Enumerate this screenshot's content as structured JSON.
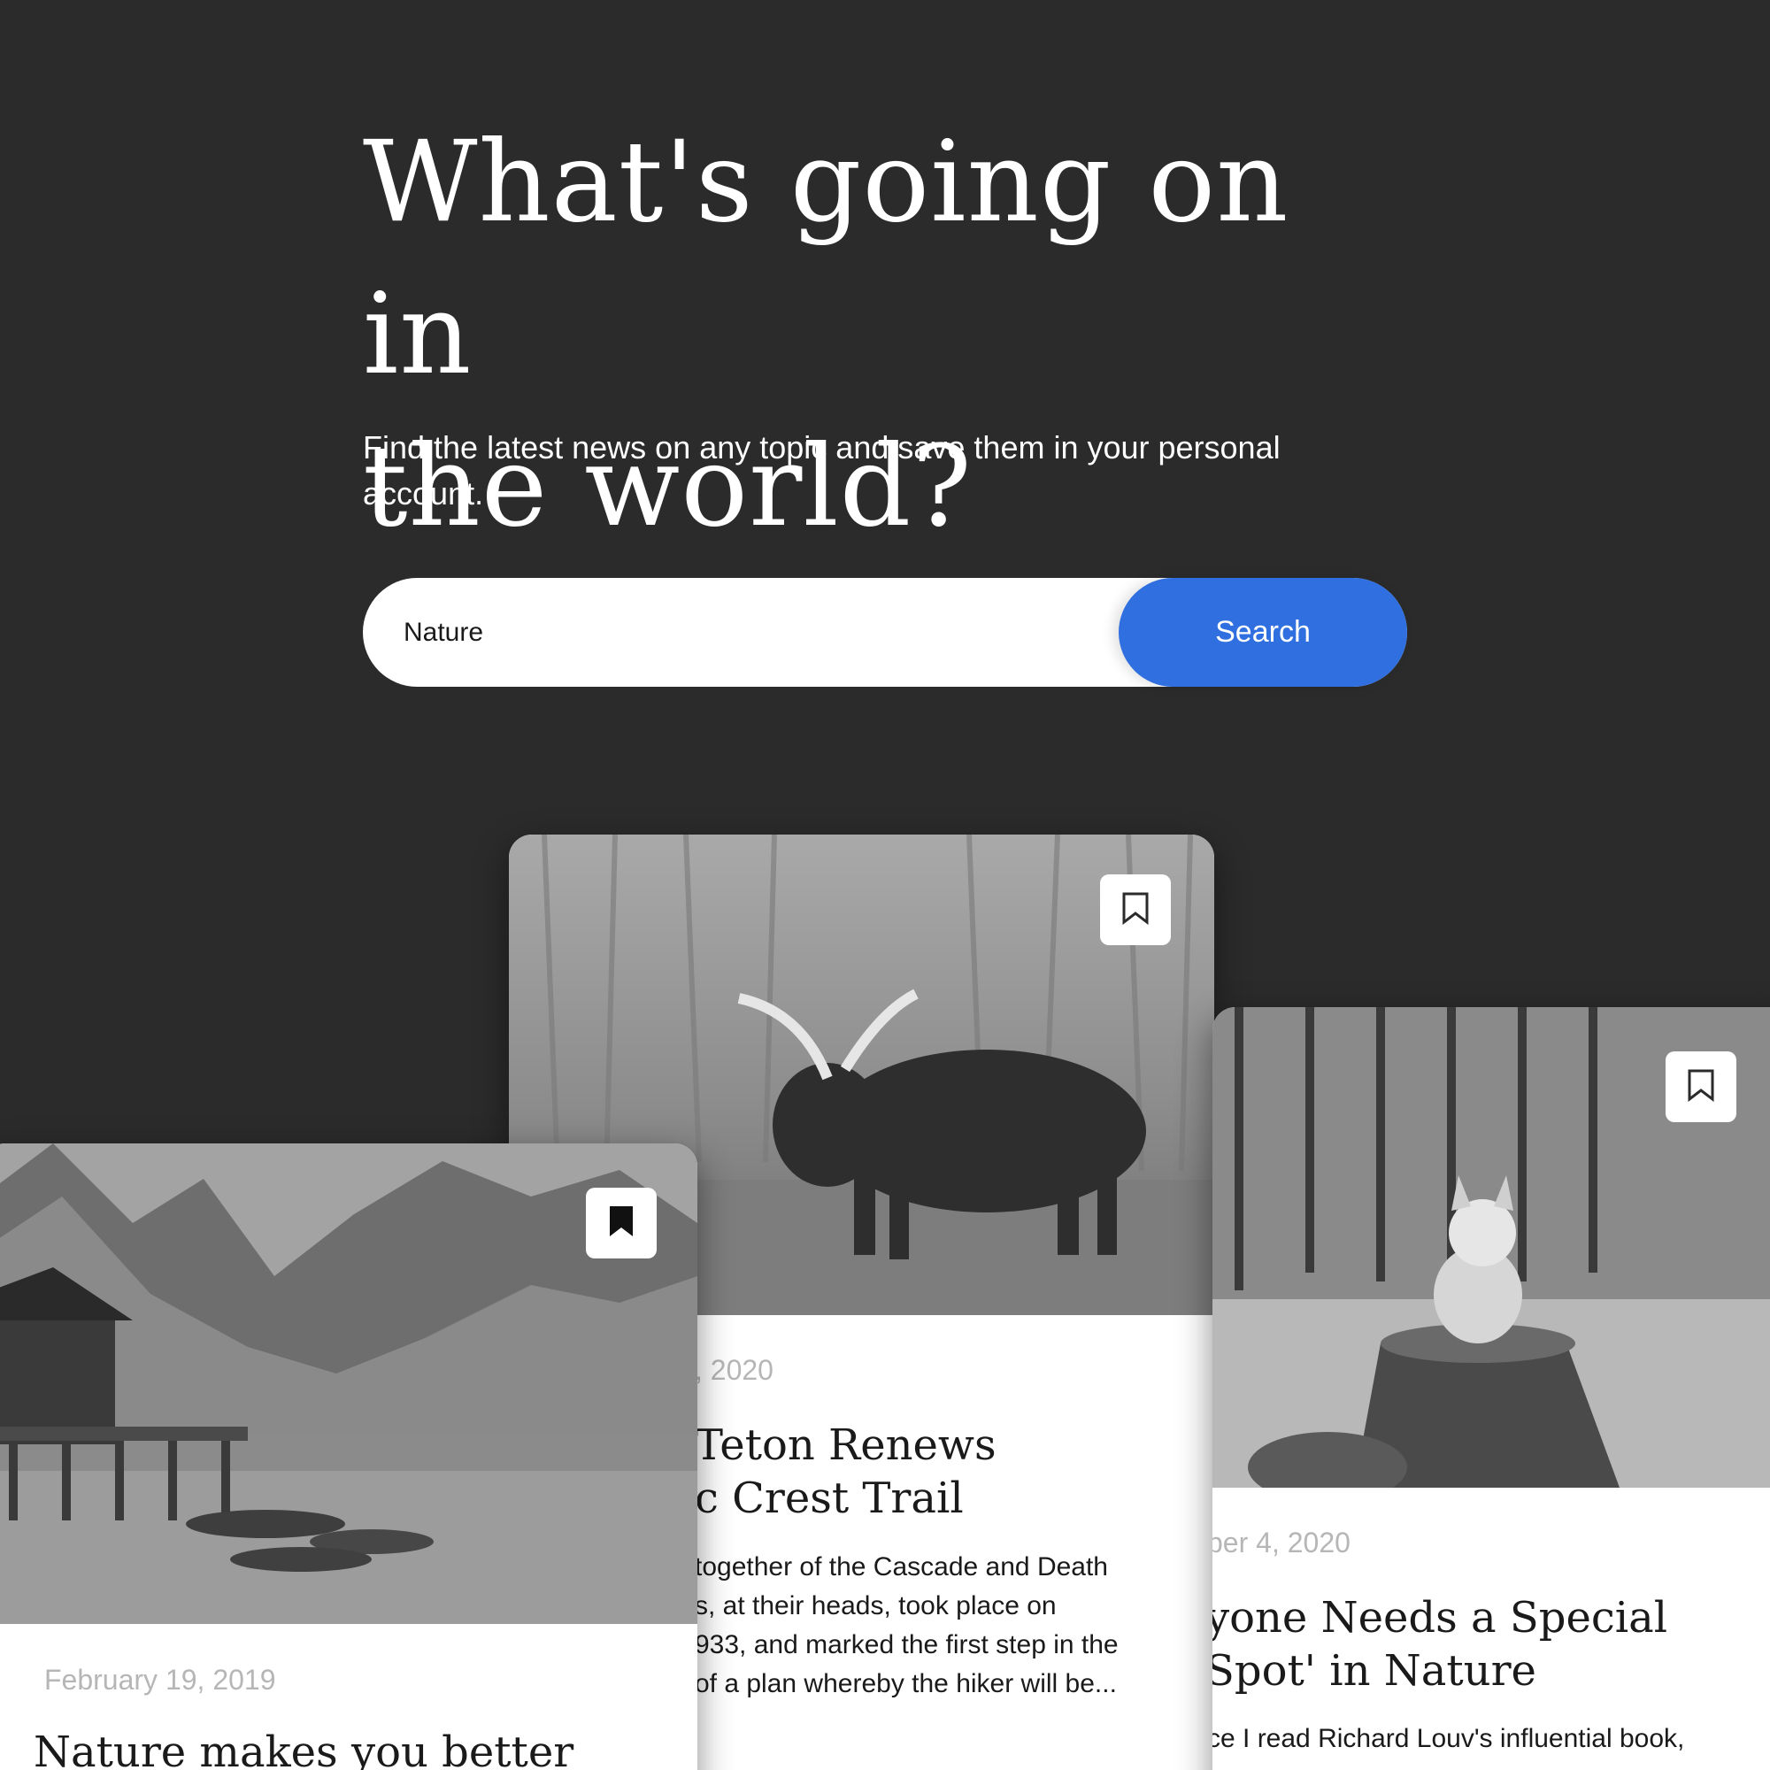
{
  "hero": {
    "title_line1": "What's going on in",
    "title_line2": "the world?",
    "subtitle_line1": "Find the latest news on any topic and save them in your personal",
    "subtitle_line2": "account."
  },
  "search": {
    "value": "Nature",
    "button_label": "Search"
  },
  "colors": {
    "background": "#2b2b2b",
    "accent": "#2f6fe0",
    "card": "#ffffff",
    "date_text": "#b6b6b6"
  },
  "cards": [
    {
      "image": "mountain-lake-with-boats",
      "bookmark_icon": "bookmark-filled-icon",
      "date": "February 19, 2019",
      "title_line1": "Nature makes you better"
    },
    {
      "image": "moose-in-forest",
      "bookmark_icon": "bookmark-outline-icon",
      "date": ", 2020",
      "title_line1": "Teton Renews",
      "title_line2": "c Crest Trail",
      "text_line1": " together of the Cascade and Death",
      "text_line2": "s, at their heads, took place on",
      "text_line3": "933, and marked the first step in the",
      "text_line4": "of a plan whereby the hiker will be..."
    },
    {
      "image": "corgi-on-tree-stump",
      "bookmark_icon": "bookmark-outline-icon",
      "date": "ber 4, 2020",
      "title_line1": "yone Needs a Special",
      "title_line2": "Spot' in Nature",
      "text_line1": "ce I read Richard Louv's influential book,"
    }
  ]
}
